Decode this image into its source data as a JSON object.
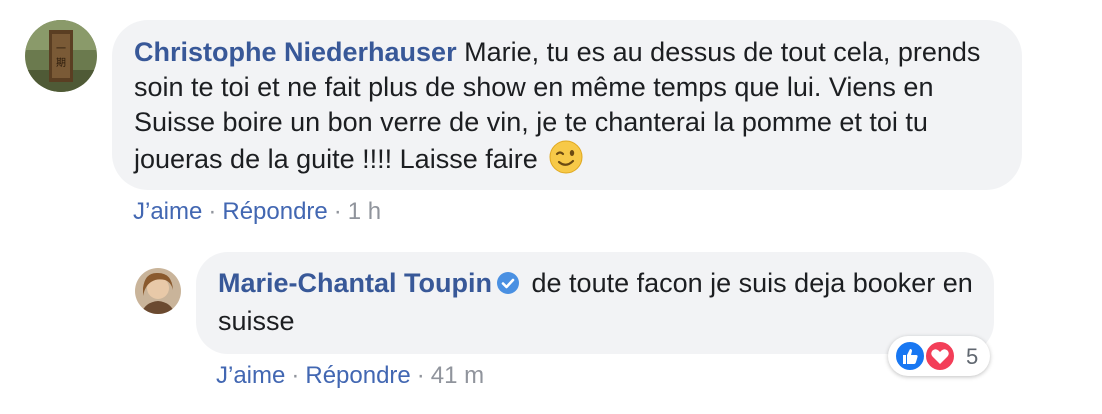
{
  "comment": {
    "author": "Christophe Niederhauser",
    "text": "Marie, tu es au dessus de tout cela, prends soin te toi et ne fait plus de show en même temps que lui. Viens en Suisse boire un bon verre de vin, je te chanterai la pomme et toi tu joueras de la guite !!!! Laisse faire",
    "emoji": "winking-face-icon",
    "like_label": "J’aime",
    "reply_label": "Répondre",
    "separator": "·",
    "timestamp": "1 h"
  },
  "reply": {
    "author": "Marie-Chantal Toupin",
    "verified_icon": "verified-badge-icon",
    "text": "de toute facon je suis deja booker en suisse",
    "like_label": "J’aime",
    "reply_label": "Répondre",
    "separator": "·",
    "timestamp": "41 m",
    "reactions": {
      "icons": [
        "like-reaction-icon",
        "love-reaction-icon"
      ],
      "count": "5"
    }
  },
  "colors": {
    "author": "#385898",
    "link": "#4267b2",
    "meta": "#90949c",
    "bubble": "#f2f3f5",
    "like": "#1877f2",
    "love": "#f33e58"
  }
}
